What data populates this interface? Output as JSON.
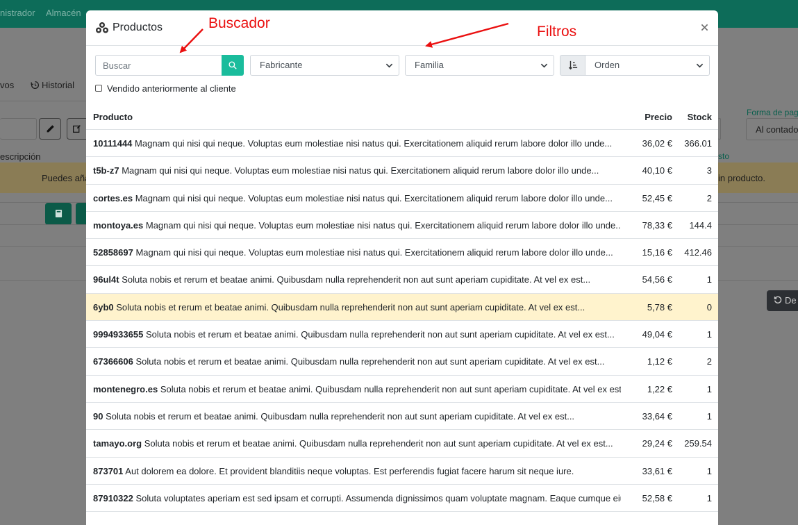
{
  "background": {
    "topbar_items": [
      "nistrador",
      "Almacén"
    ],
    "tab_partial": "vos",
    "tab_historial": "Historial",
    "col_descripcion_partial": "escripción",
    "forma_pago_label": "Forma de pag",
    "forma_pago_value": "Al contado",
    "costo_partial": "sto",
    "notice_left": "Puedes aña",
    "notice_right": "in producto.",
    "button_partial": "De"
  },
  "modal": {
    "title": "Productos",
    "search": {
      "placeholder": "Buscar"
    },
    "filters": {
      "fabricante": "Fabricante",
      "familia": "Familia",
      "orden": "Orden"
    },
    "checkbox_label": "Vendido anteriormente al cliente",
    "table": {
      "headers": {
        "producto": "Producto",
        "precio": "Precio",
        "stock": "Stock"
      },
      "rows": [
        {
          "ref": "10111444",
          "desc": "Magnam qui nisi qui neque. Voluptas eum molestiae nisi natus qui. Exercitationem aliquid rerum labore dolor illo unde...",
          "price": "36,02 €",
          "stock": "366.01",
          "highlight": false
        },
        {
          "ref": "t5b-z7",
          "desc": "Magnam qui nisi qui neque. Voluptas eum molestiae nisi natus qui. Exercitationem aliquid rerum labore dolor illo unde...",
          "price": "40,10 €",
          "stock": "3",
          "highlight": false
        },
        {
          "ref": "cortes.es",
          "desc": "Magnam qui nisi qui neque. Voluptas eum molestiae nisi natus qui. Exercitationem aliquid rerum labore dolor illo unde...",
          "price": "52,45 €",
          "stock": "2",
          "highlight": false
        },
        {
          "ref": "montoya.es",
          "desc": "Magnam qui nisi qui neque. Voluptas eum molestiae nisi natus qui. Exercitationem aliquid rerum labore dolor illo unde...",
          "price": "78,33 €",
          "stock": "144.4",
          "highlight": false
        },
        {
          "ref": "52858697",
          "desc": "Magnam qui nisi qui neque. Voluptas eum molestiae nisi natus qui. Exercitationem aliquid rerum labore dolor illo unde...",
          "price": "15,16 €",
          "stock": "412.46",
          "highlight": false
        },
        {
          "ref": "96ul4t",
          "desc": "Soluta nobis et rerum et beatae animi. Quibusdam nulla reprehenderit non aut sunt aperiam cupiditate. At vel ex est...",
          "price": "54,56 €",
          "stock": "1",
          "highlight": false
        },
        {
          "ref": "6yb0",
          "desc": "Soluta nobis et rerum et beatae animi. Quibusdam nulla reprehenderit non aut sunt aperiam cupiditate. At vel ex est...",
          "price": "5,78 €",
          "stock": "0",
          "highlight": true
        },
        {
          "ref": "9994933655",
          "desc": "Soluta nobis et rerum et beatae animi. Quibusdam nulla reprehenderit non aut sunt aperiam cupiditate. At vel ex est...",
          "price": "49,04 €",
          "stock": "1",
          "highlight": false
        },
        {
          "ref": "67366606",
          "desc": "Soluta nobis et rerum et beatae animi. Quibusdam nulla reprehenderit non aut sunt aperiam cupiditate. At vel ex est...",
          "price": "1,12 €",
          "stock": "2",
          "highlight": false
        },
        {
          "ref": "montenegro.es",
          "desc": "Soluta nobis et rerum et beatae animi. Quibusdam nulla reprehenderit non aut sunt aperiam cupiditate. At vel ex est...",
          "price": "1,22 €",
          "stock": "1",
          "highlight": false
        },
        {
          "ref": "90",
          "desc": "Soluta nobis et rerum et beatae animi. Quibusdam nulla reprehenderit non aut sunt aperiam cupiditate. At vel ex est...",
          "price": "33,64 €",
          "stock": "1",
          "highlight": false
        },
        {
          "ref": "tamayo.org",
          "desc": "Soluta nobis et rerum et beatae animi. Quibusdam nulla reprehenderit non aut sunt aperiam cupiditate. At vel ex est...",
          "price": "29,24 €",
          "stock": "259.54",
          "highlight": false
        },
        {
          "ref": "873701",
          "desc": "Aut dolorem ea dolore. Et provident blanditiis neque voluptas. Est perferendis fugiat facere harum sit neque iure.",
          "price": "33,61 €",
          "stock": "1",
          "highlight": false
        },
        {
          "ref": "87910322",
          "desc": "Soluta voluptates aperiam est sed ipsam et corrupti. Assumenda dignissimos quam voluptate magnam. Eaque cumque eius...",
          "price": "52,58 €",
          "stock": "1",
          "highlight": false
        }
      ]
    }
  },
  "annotations": {
    "buscador": "Buscador",
    "filtros": "Filtros",
    "color": "#ea0f0f"
  },
  "colors": {
    "accent": "#1abc9c",
    "highlight_row": "#fff3cd"
  }
}
